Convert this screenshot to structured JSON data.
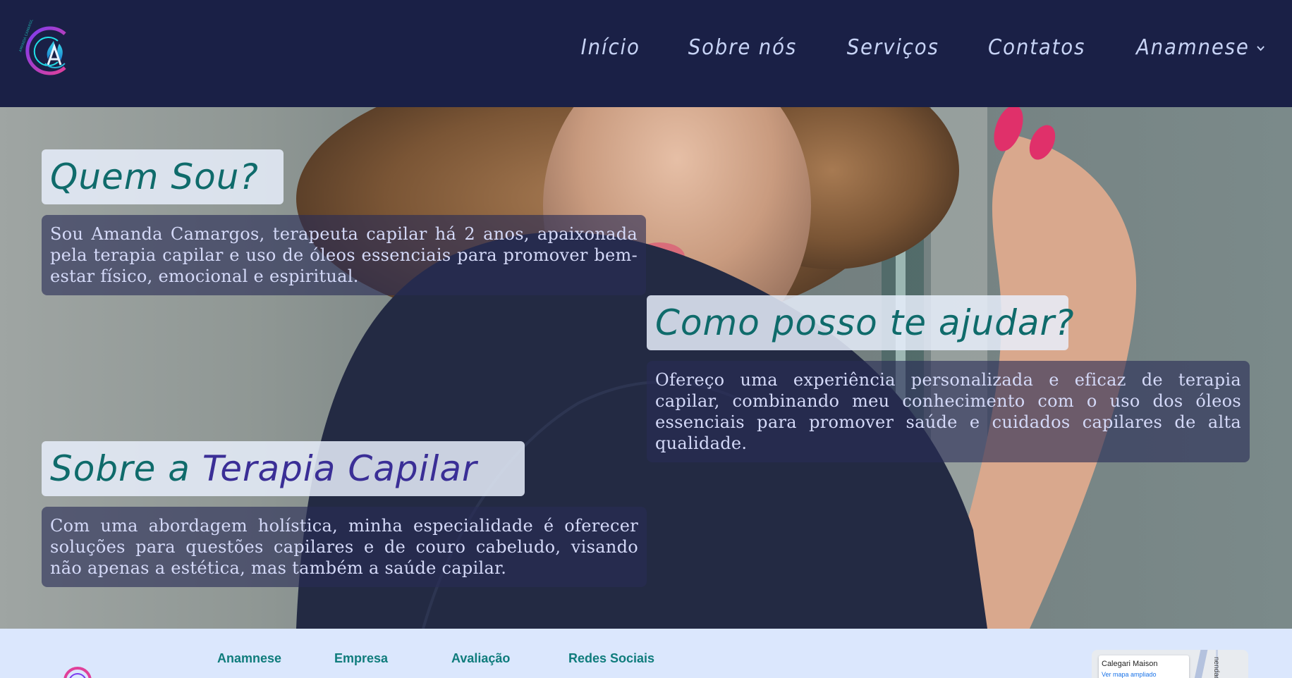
{
  "nav": {
    "logo_text": "AMANDA CAMARGOS",
    "items": [
      {
        "label": "Início"
      },
      {
        "label": "Sobre nós"
      },
      {
        "label": "Serviços"
      },
      {
        "label": "Contatos"
      },
      {
        "label": "Anamnese",
        "has_dropdown": true
      }
    ]
  },
  "sections": [
    {
      "title": "Quem Sou?",
      "text": "Sou Amanda Camargos, terapeuta capilar há 2 anos, apaixonada pela terapia capilar e uso de óleos essenciais para promover bem-estar físico, emocional e espiritual."
    },
    {
      "title": "Como posso te ajudar?",
      "text": "Ofereço uma experiência personalizada e eficaz de terapia capilar, combinando meu conhecimento com o uso dos óleos essenciais para promover saúde e cuidados capilares de alta qualidade."
    },
    {
      "title_part1": "Sobre a",
      "title_part2": "Terapia Capilar",
      "text": "Com uma abordagem holística, minha especialidade é oferecer soluções para questões capilares e de couro cabeludo, visando não apenas a estética, mas também a saúde capilar."
    }
  ],
  "footer": {
    "columns": [
      "Anamnese",
      "Empresa",
      "Avaliação",
      "Redes Sociais"
    ],
    "map": {
      "place_name": "Calegari Maison",
      "link": "Ver mapa ampliado",
      "street": "nendado"
    }
  },
  "colors": {
    "navbar_bg": "#1a2046",
    "nav_text": "#c7d3f5",
    "title_teal": "#0f6b6b",
    "title_purple": "#3a2e96",
    "footer_bg": "#dbe7fd",
    "footer_heading": "#0f7c7c"
  }
}
